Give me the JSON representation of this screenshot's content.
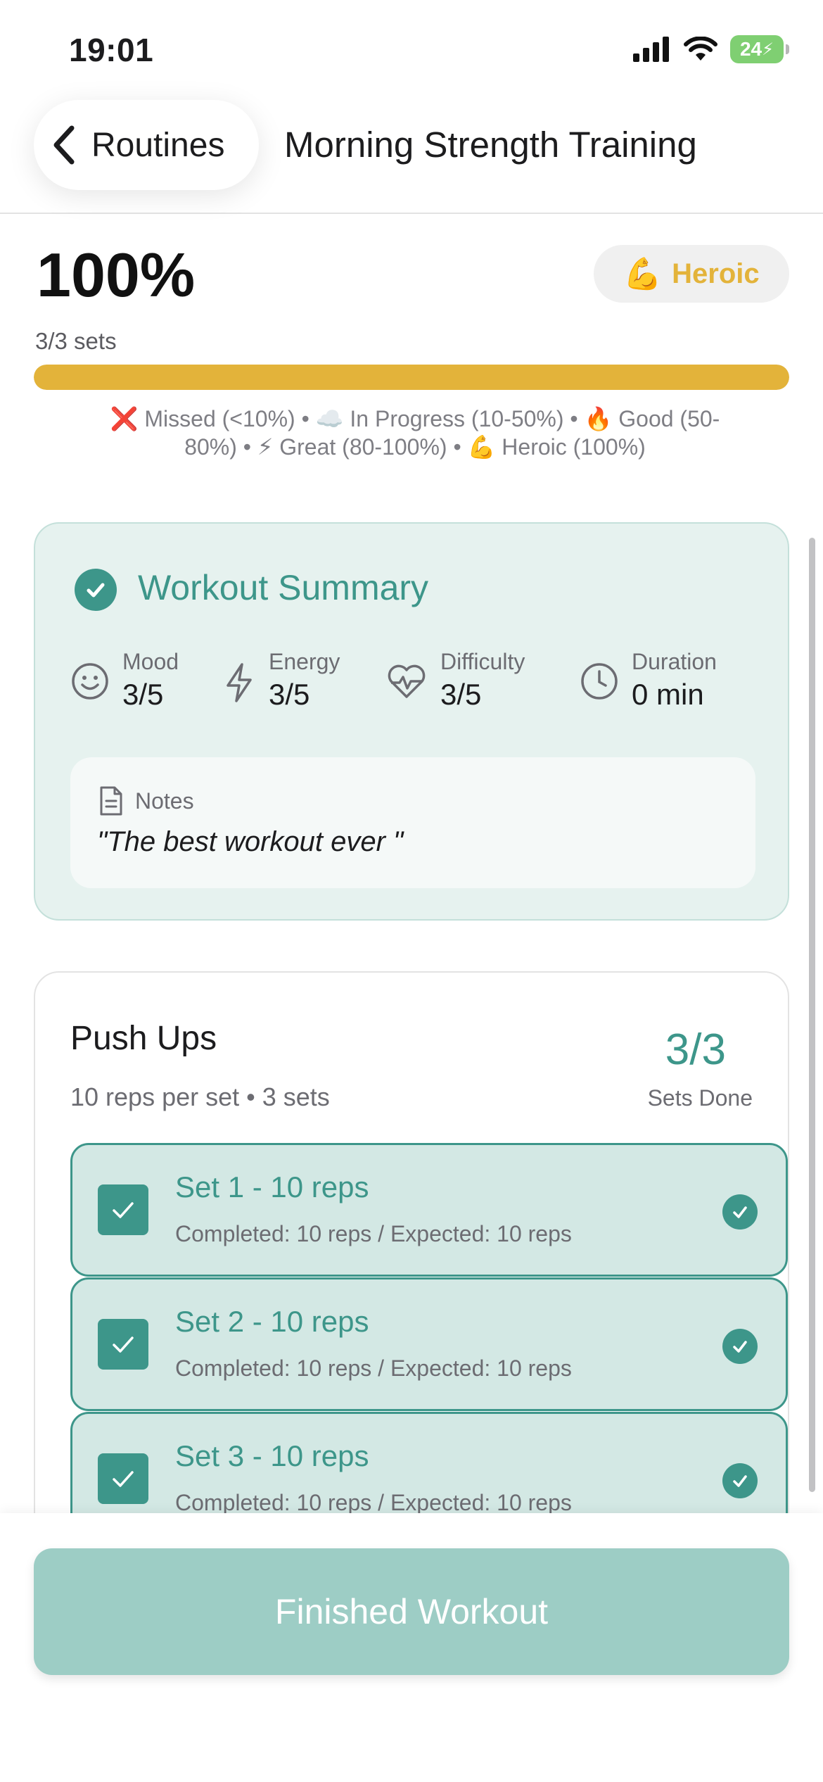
{
  "status_bar": {
    "time": "19:01",
    "battery": "24"
  },
  "header": {
    "back_label": "Routines",
    "title": "Morning Strength Training"
  },
  "progress": {
    "percent_label": "100%",
    "percent_value": 1.0,
    "tier_emoji": "💪",
    "tier_label": "Heroic",
    "sets_label": "3/3 sets",
    "legend": "❌ Missed (<10%) • ☁️ In Progress (10-50%) • 🔥 Good (50-80%) • ⚡ Great (80-100%) • 💪 Heroic (100%)"
  },
  "summary": {
    "title": "Workout Summary",
    "metrics": [
      {
        "icon": "smile-icon",
        "label": "Mood",
        "value": "3/5"
      },
      {
        "icon": "lightning-icon",
        "label": "Energy",
        "value": "3/5"
      },
      {
        "icon": "heart-pulse-icon",
        "label": "Difficulty",
        "value": "3/5"
      },
      {
        "icon": "clock-icon",
        "label": "Duration",
        "value": "0 min"
      }
    ],
    "notes_label": "Notes",
    "notes_text": "\"The best workout ever \""
  },
  "exercise": {
    "name": "Push Ups",
    "meta": "10 reps per set • 3 sets",
    "done_count": "3/3",
    "done_label": "Sets Done",
    "sets": [
      {
        "title": "Set 1 - 10 reps",
        "subtitle": "Completed: 10 reps / Expected: 10 reps",
        "checked": true
      },
      {
        "title": "Set 2 - 10 reps",
        "subtitle": "Completed: 10 reps / Expected: 10 reps",
        "checked": true
      },
      {
        "title": "Set 3 - 10 reps",
        "subtitle": "Completed: 10 reps / Expected: 10 reps",
        "checked": true
      }
    ]
  },
  "footer": {
    "finish_label": "Finished Workout"
  },
  "colors": {
    "accent": "#3d968a",
    "gold": "#e3b33a",
    "summary_bg": "#e6f2ef",
    "set_bg": "#d3e8e4",
    "button_disabled": "#9dcdc5"
  }
}
